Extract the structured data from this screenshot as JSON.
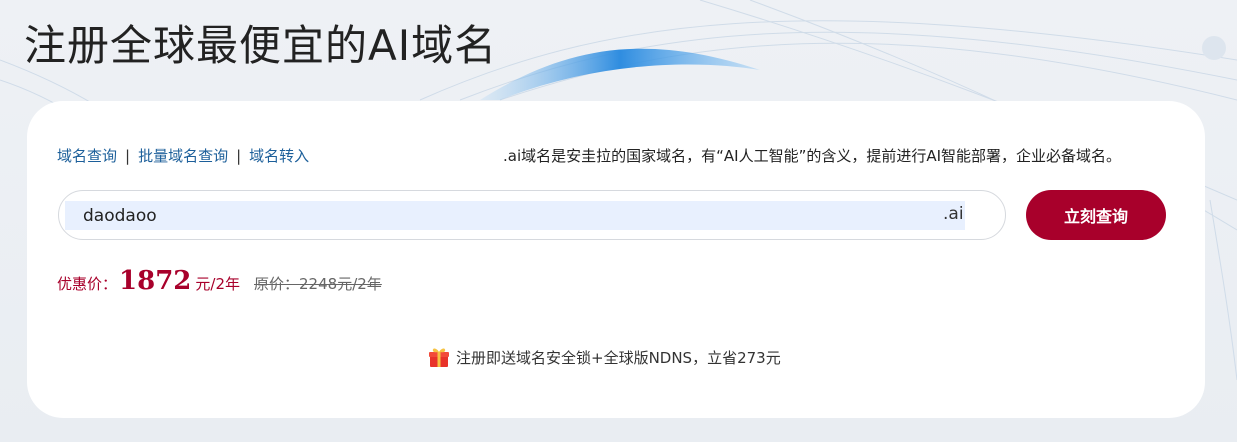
{
  "banner": {
    "title": "注册全球最便宜的AI域名"
  },
  "search_panel": {
    "nav_links": [
      "域名查询",
      "批量域名查询",
      "域名转入"
    ],
    "separator": "|",
    "description": ".ai域名是安圭拉的国家域名，有“AI人工智能”的含义，提前进行AI智能部署，企业必备域名。",
    "search_input_value": "daodaoo",
    "tld_suffix": ".ai",
    "search_button_label": "立刻查询"
  },
  "pricing": {
    "label": "优惠价：",
    "value": "1872",
    "unit": "元/2年",
    "original_label": "原价：",
    "original_value": "2248元/2年"
  },
  "promo": {
    "icon": "gift-icon",
    "text": "注册即送域名安全锁+全球版NDNS，立省273元"
  },
  "colors": {
    "accent": "#a8002b",
    "link": "#1c5f9a",
    "input_fill": "#e8f0fe"
  }
}
